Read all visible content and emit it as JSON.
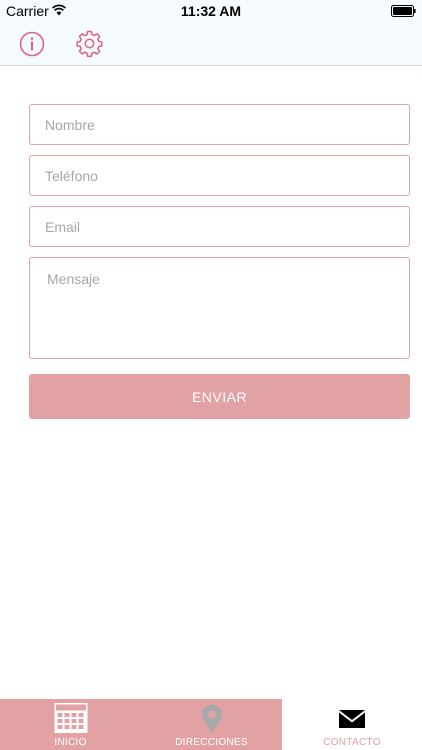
{
  "status_bar": {
    "carrier": "Carrier",
    "time": "11:32 AM"
  },
  "nav_bar": {
    "left_icons": [
      "info-icon",
      "gear-icon"
    ]
  },
  "form": {
    "nombre_placeholder": "Nombre",
    "telefono_placeholder": "Teléfono",
    "email_placeholder": "Email",
    "mensaje_placeholder": "Mensaje",
    "submit_label": "ENVIAR"
  },
  "tab_bar": {
    "tabs": [
      {
        "label": "INICIO",
        "icon": "calendar-icon",
        "selected": false
      },
      {
        "label": "DIRECCIONES",
        "icon": "map-pin-icon",
        "selected": false
      },
      {
        "label": "CONTACTO",
        "icon": "envelope-icon",
        "selected": true
      }
    ]
  },
  "colors": {
    "accent": "#e2a2a4",
    "icon_accent": "#e0637d",
    "bar_background": "#f4fafe",
    "placeholder": "#a6a6a6"
  }
}
